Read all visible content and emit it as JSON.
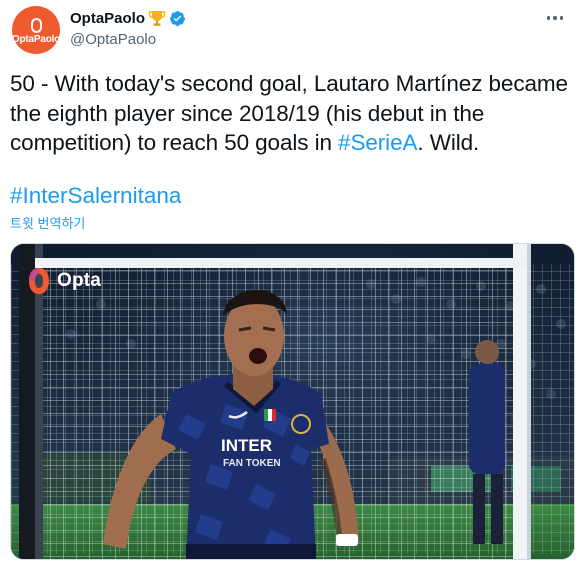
{
  "author": {
    "display_name": "OptaPaolo",
    "handle": "@OptaPaolo",
    "avatar_text": "OptaPaolo",
    "badge_icon": "trophy-icon",
    "verified_icon": "verified-icon"
  },
  "tweet": {
    "text_before": "50 - With today's second goal, Lautaro Martínez became the eighth player since 2018/19 (his debut in the competition) to reach 50 goals in ",
    "hashtag_inline": "#SerieA",
    "text_after": ". Wild.",
    "hashtag_line": "#InterSalernitana",
    "translate_label": "트윗 번역하기"
  },
  "media": {
    "watermark": "Opta",
    "jersey_sponsor": "INTER",
    "jersey_sub": "FAN TOKEN",
    "colors": {
      "jersey_blue": "#1b2d6b",
      "net_white": "#e8eef4",
      "pitch_green": "#2f7a3a",
      "skin": "#9c6a4c"
    }
  },
  "colors": {
    "link": "#1d9bf0",
    "text": "#0f1419",
    "secondary": "#536471",
    "avatar_bg": "#ef5a2f"
  }
}
